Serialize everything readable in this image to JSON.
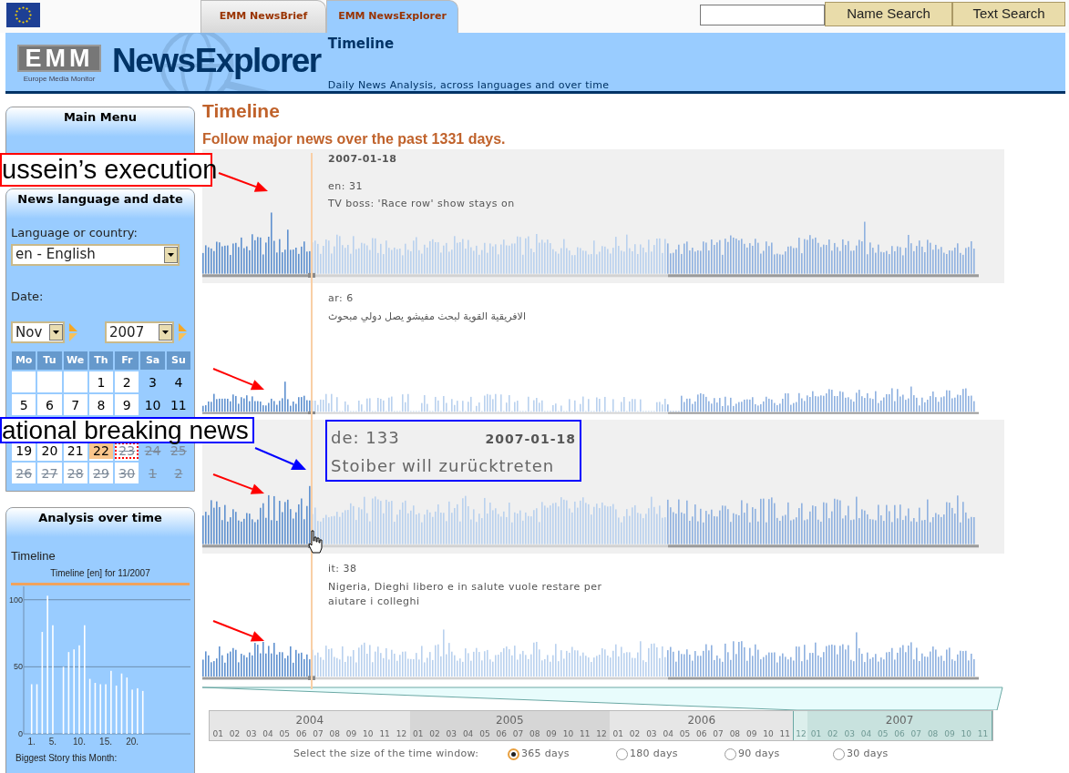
{
  "header": {
    "tabs": [
      {
        "label": "EMM NewsBrief",
        "selected": false
      },
      {
        "label": "EMM NewsExplorer",
        "selected": true
      }
    ],
    "buttons": [
      "Name Search",
      "Text Search"
    ]
  },
  "banner": {
    "logo_letters": "EMM",
    "logo_caption": "Europe Media Monitor",
    "product": "NewsExplorer",
    "title": "Timeline",
    "subtitle": "Daily News Analysis, across languages and over time"
  },
  "sidebar": {
    "main_menu": {
      "title": "Main Menu"
    },
    "language_date": {
      "title": "News language and date",
      "language_label": "Language or country:",
      "language": "en - English",
      "date_label": "Date:",
      "month": "Nov",
      "year": "2007",
      "weekdays": [
        "Mo",
        "Tu",
        "We",
        "Th",
        "Fr",
        "Sa",
        "Su"
      ],
      "weeks_top": [
        [
          {
            "kind": "empty"
          },
          {
            "kind": "empty"
          },
          {
            "kind": "empty"
          },
          {
            "kind": "day",
            "text": "1",
            "today": false,
            "selected": false,
            "disabled": false
          },
          {
            "kind": "day",
            "text": "2",
            "today": false,
            "selected": false,
            "disabled": false
          },
          {
            "kind": "day",
            "text": "3",
            "today": false,
            "selected": false,
            "disabled": false
          },
          {
            "kind": "day",
            "text": "4",
            "today": false,
            "selected": false,
            "disabled": false
          }
        ],
        [
          {
            "kind": "day",
            "text": "5",
            "today": false,
            "selected": false,
            "disabled": false
          },
          {
            "kind": "day",
            "text": "6",
            "today": false,
            "selected": false,
            "disabled": false
          },
          {
            "kind": "day",
            "text": "7",
            "today": false,
            "selected": false,
            "disabled": false
          },
          {
            "kind": "day",
            "text": "8",
            "today": false,
            "selected": false,
            "disabled": false
          },
          {
            "kind": "day",
            "text": "9",
            "today": false,
            "selected": false,
            "disabled": false
          },
          {
            "kind": "day",
            "text": "10",
            "today": false,
            "selected": false,
            "disabled": false
          },
          {
            "kind": "day",
            "text": "11",
            "today": false,
            "selected": false,
            "disabled": false
          }
        ]
      ],
      "weeks_bottom": [
        [
          {
            "kind": "day",
            "text": "19",
            "today": false,
            "selected": false,
            "disabled": false
          },
          {
            "kind": "day",
            "text": "20",
            "today": false,
            "selected": false,
            "disabled": false
          },
          {
            "kind": "day",
            "text": "21",
            "today": false,
            "selected": false,
            "disabled": false
          },
          {
            "kind": "day",
            "text": "22",
            "today": true,
            "selected": false,
            "disabled": false
          },
          {
            "kind": "day",
            "text": "23",
            "today": false,
            "selected": true,
            "disabled": true
          },
          {
            "kind": "day",
            "text": "24",
            "today": false,
            "selected": false,
            "disabled": true
          },
          {
            "kind": "day",
            "text": "25",
            "today": false,
            "selected": false,
            "disabled": true
          }
        ],
        [
          {
            "kind": "day",
            "text": "26",
            "today": false,
            "selected": false,
            "disabled": true
          },
          {
            "kind": "day",
            "text": "27",
            "today": false,
            "selected": false,
            "disabled": true
          },
          {
            "kind": "day",
            "text": "28",
            "today": false,
            "selected": false,
            "disabled": true
          },
          {
            "kind": "day",
            "text": "29",
            "today": false,
            "selected": false,
            "disabled": true
          },
          {
            "kind": "day",
            "text": "30",
            "today": false,
            "selected": false,
            "disabled": true
          },
          {
            "kind": "day",
            "text": "1",
            "today": false,
            "selected": false,
            "disabled": true
          },
          {
            "kind": "day",
            "text": "2",
            "today": false,
            "selected": false,
            "disabled": true
          }
        ]
      ]
    },
    "analysis": {
      "title": "Analysis over time",
      "link": "Timeline",
      "footer": "Biggest Story this Month:",
      "chart_data": {
        "type": "bar",
        "title": "Timeline [en] for 11/2007",
        "x": [
          1,
          2,
          3,
          4,
          5,
          6,
          7,
          8,
          9,
          10,
          11,
          12,
          13,
          14,
          15,
          16,
          17,
          18,
          19,
          20,
          21,
          22
        ],
        "series": [
          {
            "color": "#ffffff",
            "values": [
              37,
              37,
              76,
              103,
              81,
              null,
              50,
              61,
              63,
              66,
              81,
              41,
              38,
              37,
              37,
              47,
              36,
              45,
              42,
              33,
              34,
              32
            ]
          }
        ],
        "xlim": [
          -0.5,
          31
        ],
        "ylim": [
          0,
          110
        ],
        "yticks": [
          0,
          50,
          100
        ],
        "xticks": [
          {
            "value": 1,
            "label": "1."
          },
          {
            "value": 5,
            "label": "5."
          },
          {
            "value": 10,
            "label": "10."
          },
          {
            "value": 15,
            "label": "15."
          },
          {
            "value": 20,
            "label": "20."
          }
        ]
      }
    }
  },
  "main": {
    "title": "Timeline",
    "subtitle": "Follow major news over the past 1331 days.",
    "panels": [
      {
        "kind": "plain",
        "shaded": true,
        "date": "2007-01-18",
        "count": "en: 31",
        "headline": "TV boss: 'Race row' show stays on"
      },
      {
        "kind": "plain",
        "shaded": false,
        "count": "ar: 6",
        "headline": "الافريقية القوية لبحث مفيشو يصل دولي مبحوث"
      },
      {
        "kind": "callout",
        "shaded": true,
        "date": "2007-01-18",
        "count": "de: 133",
        "headline": "Stoiber will zurücktreten"
      },
      {
        "kind": "plain",
        "shaded": false,
        "count": "it: 38",
        "headline": "Nigeria, Dieghi libero e in salute vuole restare per aiutare i colleghi"
      }
    ],
    "axis": [
      {
        "year": "2004",
        "selected": false,
        "months": [
          {
            "text": "01",
            "selected": false
          },
          {
            "text": "02",
            "selected": false
          },
          {
            "text": "03",
            "selected": false
          },
          {
            "text": "04",
            "selected": false
          },
          {
            "text": "05",
            "selected": false
          },
          {
            "text": "06",
            "selected": false
          },
          {
            "text": "07",
            "selected": false
          },
          {
            "text": "08",
            "selected": false
          },
          {
            "text": "09",
            "selected": false
          },
          {
            "text": "10",
            "selected": false
          },
          {
            "text": "11",
            "selected": false
          },
          {
            "text": "12",
            "selected": false
          }
        ]
      },
      {
        "year": "2005",
        "selected": false,
        "months": [
          {
            "text": "01",
            "selected": false
          },
          {
            "text": "02",
            "selected": false
          },
          {
            "text": "03",
            "selected": false
          },
          {
            "text": "04",
            "selected": false
          },
          {
            "text": "05",
            "selected": false
          },
          {
            "text": "06",
            "selected": false
          },
          {
            "text": "07",
            "selected": false
          },
          {
            "text": "08",
            "selected": false
          },
          {
            "text": "09",
            "selected": false
          },
          {
            "text": "10",
            "selected": false
          },
          {
            "text": "11",
            "selected": false
          },
          {
            "text": "12",
            "selected": false
          }
        ]
      },
      {
        "year": "2006",
        "selected": false,
        "months": [
          {
            "text": "01",
            "selected": false
          },
          {
            "text": "02",
            "selected": false
          },
          {
            "text": "03",
            "selected": false
          },
          {
            "text": "04",
            "selected": false
          },
          {
            "text": "05",
            "selected": false
          },
          {
            "text": "06",
            "selected": false
          },
          {
            "text": "07",
            "selected": false
          },
          {
            "text": "08",
            "selected": false
          },
          {
            "text": "09",
            "selected": false
          },
          {
            "text": "10",
            "selected": false
          },
          {
            "text": "11",
            "selected": false
          },
          {
            "text": "12",
            "selected": true
          }
        ]
      },
      {
        "year": "2007",
        "selected": true,
        "months": [
          {
            "text": "01",
            "selected": true
          },
          {
            "text": "02",
            "selected": true
          },
          {
            "text": "03",
            "selected": true
          },
          {
            "text": "04",
            "selected": true
          },
          {
            "text": "05",
            "selected": true
          },
          {
            "text": "06",
            "selected": true
          },
          {
            "text": "07",
            "selected": true
          },
          {
            "text": "08",
            "selected": true
          },
          {
            "text": "09",
            "selected": true
          },
          {
            "text": "10",
            "selected": true
          },
          {
            "text": "11",
            "selected": true
          }
        ]
      }
    ],
    "window_size": {
      "label": "Select the size of the time window:",
      "options": [
        {
          "label": "365 days",
          "selected": true
        },
        {
          "label": "180 days",
          "selected": false
        },
        {
          "label": "90 days",
          "selected": false
        },
        {
          "label": "30 days",
          "selected": false
        }
      ]
    }
  },
  "annotations": [
    {
      "text": "ussein’s execution",
      "color": "#ff0000"
    },
    {
      "text": "ational breaking news",
      "color": "#0000ff"
    }
  ]
}
